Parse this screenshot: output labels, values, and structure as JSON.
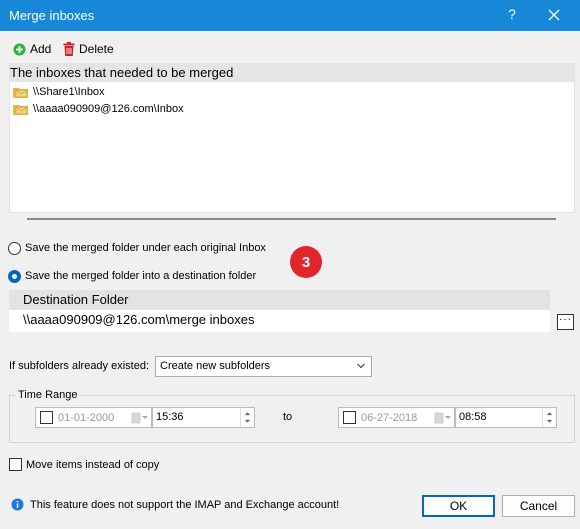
{
  "window": {
    "title": "Merge inboxes",
    "help_label": "?"
  },
  "toolbar": {
    "add_label": "Add",
    "delete_label": "Delete"
  },
  "inbox_list": {
    "header": "The inboxes that needed to be merged",
    "items": [
      "\\\\Share1\\Inbox",
      "\\\\aaaa090909@126.com\\Inbox"
    ]
  },
  "options": {
    "save_under_original": "Save the merged folder under each original Inbox",
    "save_into_destination": "Save the merged folder into a destination folder"
  },
  "step_badge": "3",
  "destination": {
    "header": "Destination Folder",
    "value": "\\\\aaaa090909@126.com\\merge inboxes",
    "browse_label": "···"
  },
  "subfolders": {
    "label": "If subfolders already existed:",
    "selected": "Create new subfolders"
  },
  "time_range": {
    "legend": "Time Range",
    "from_date": "01-01-2000",
    "from_time": "15:36",
    "to_label": "to",
    "to_date": "06-27-2018",
    "to_time": "08:58"
  },
  "move_items_label": "Move items instead of copy",
  "info_text": "This feature does not support the IMAP and Exchange account!",
  "buttons": {
    "ok": "OK",
    "cancel": "Cancel"
  },
  "colors": {
    "titlebar": "#1787d8",
    "accent": "#0067c0",
    "badge": "#e0252b",
    "add_icon": "#2db336",
    "delete_icon": "#c8262a"
  }
}
